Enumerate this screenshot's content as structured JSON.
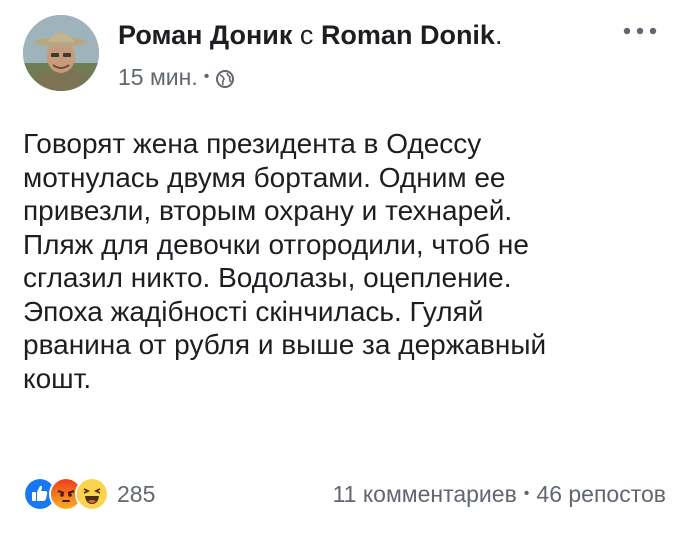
{
  "author": {
    "name": "Роман Доник",
    "with_word": "с",
    "tagged": "Roman Donik",
    "end_punct": "."
  },
  "meta": {
    "time": "15 мин.",
    "separator": "•",
    "privacy_icon": "globe-icon"
  },
  "more_icon": "more-options-icon",
  "post": {
    "lines": [
      "Говорят жена президента в Одессу",
      "мотнулась двумя бортами. Одним ее",
      "привезли, вторым охрану и технарей.",
      "Пляж для девочки отгородили, чтоб не",
      "сглазил никто. Водолазы, оцепление.",
      "Эпоха жадібності скінчилась. Гуляй",
      "рванина от рубля и выше за державный",
      "кошт."
    ]
  },
  "reactions": {
    "icons": [
      "like-icon",
      "angry-icon",
      "haha-icon"
    ],
    "count": "285"
  },
  "stats": {
    "comments": "11 комментариев",
    "separator": "•",
    "shares": "46 репостов"
  },
  "colors": {
    "text": "#1c1e21",
    "secondary": "#606770",
    "like_blue": "#1877f2",
    "angry_top": "#f23a1e",
    "angry_bottom": "#f7b125",
    "haha_yellow": "#fcd34d"
  }
}
